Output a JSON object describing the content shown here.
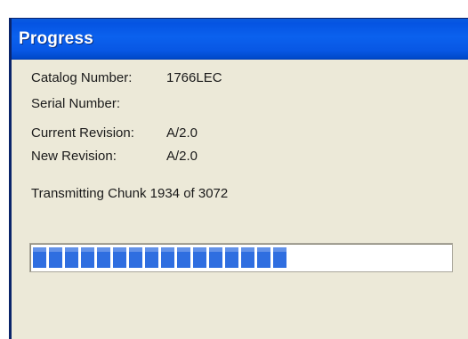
{
  "window": {
    "title": "Progress"
  },
  "info": {
    "catalog_label": "Catalog Number:",
    "catalog_value": "1766LEC",
    "serial_label": "Serial Number:",
    "serial_value": "",
    "current_revision_label": "Current Revision:",
    "current_revision_value": "A/2.0",
    "new_revision_label": "New Revision:",
    "new_revision_value": "A/2.0"
  },
  "status": {
    "text": "Transmitting Chunk 1934 of 3072"
  },
  "progress": {
    "current": 1934,
    "total": 3072,
    "fraction": 0.63
  },
  "colors": {
    "titlebar": "#0b61ee",
    "progress_block": "#2f6ee0",
    "window_bg": "#ece9d8"
  }
}
